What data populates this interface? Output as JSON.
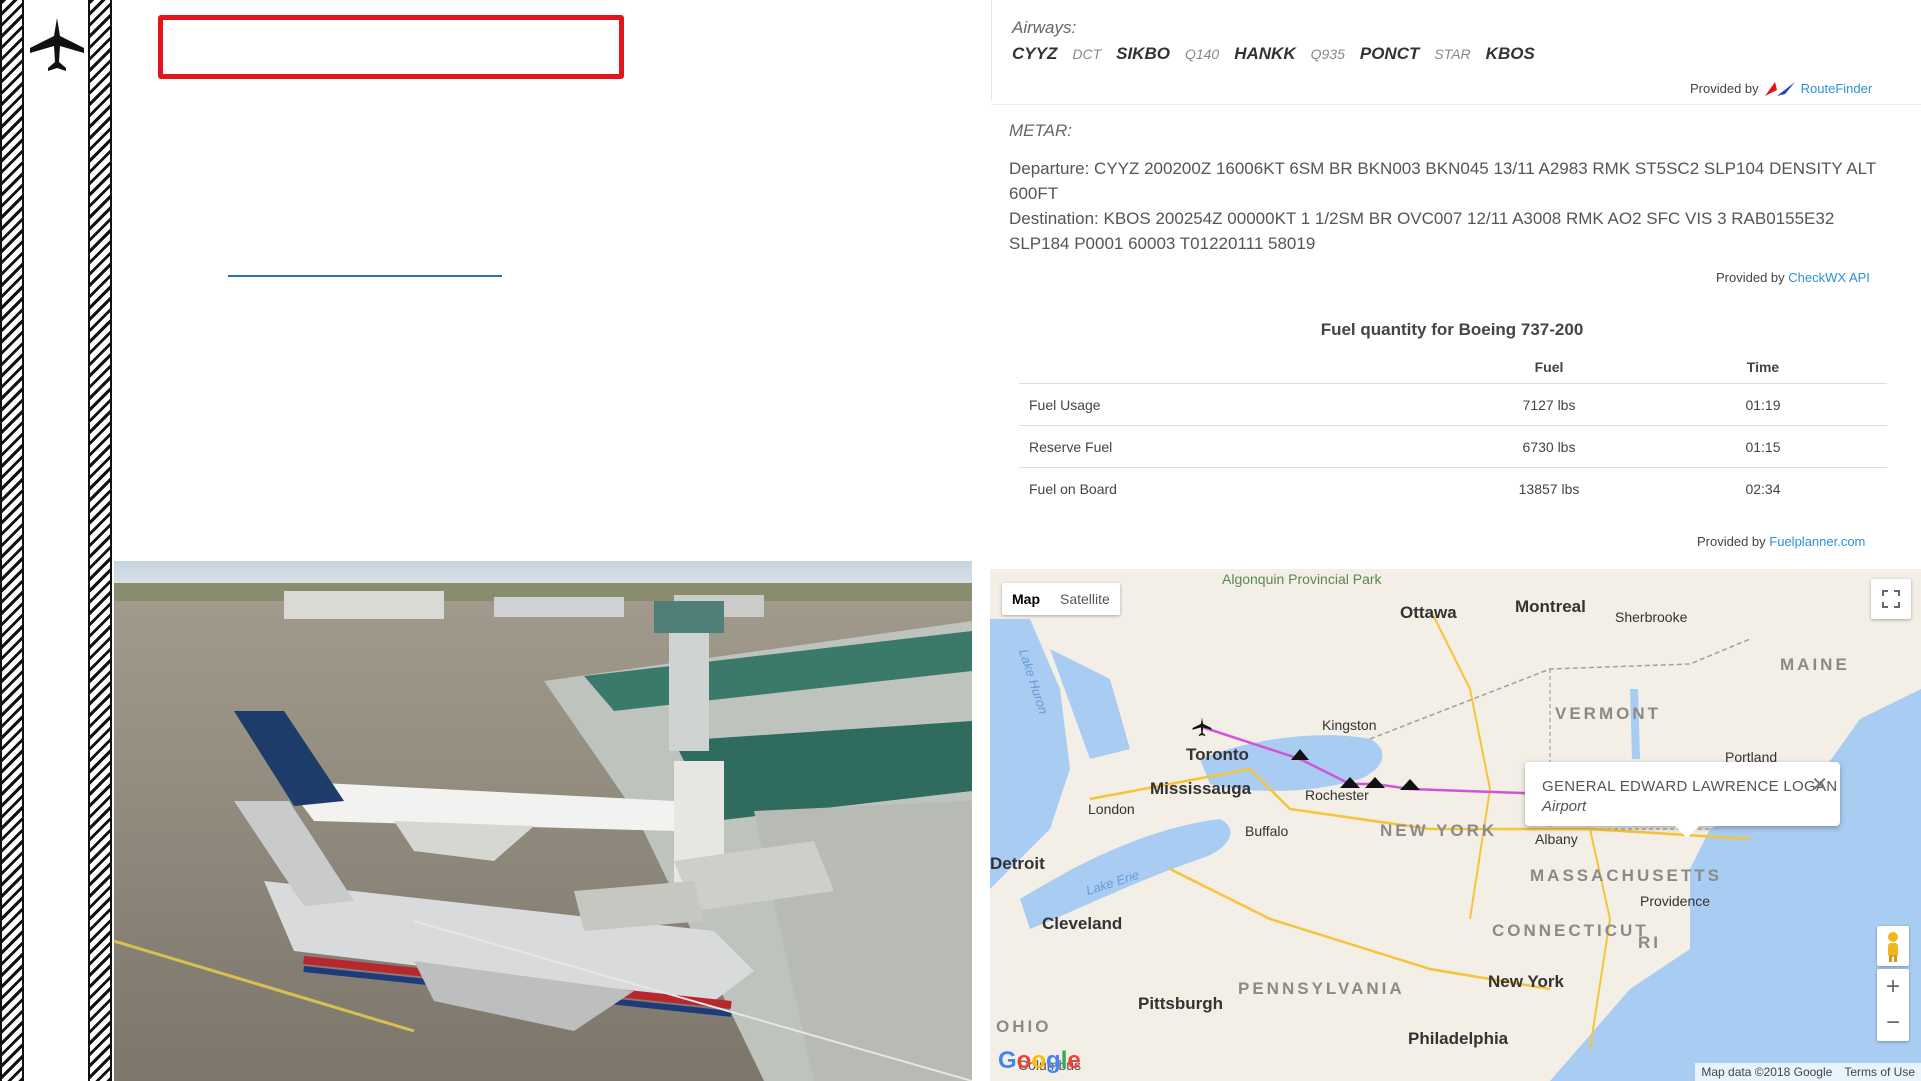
{
  "airways": {
    "label": "Airways:",
    "route": [
      {
        "id": "CYYZ",
        "kind": "waypoint"
      },
      {
        "id": "DCT",
        "kind": "airway"
      },
      {
        "id": "SIKBO",
        "kind": "waypoint"
      },
      {
        "id": "Q140",
        "kind": "airway"
      },
      {
        "id": "HANKK",
        "kind": "waypoint"
      },
      {
        "id": "Q935",
        "kind": "airway"
      },
      {
        "id": "PONCT",
        "kind": "waypoint"
      },
      {
        "id": "STAR",
        "kind": "airway"
      },
      {
        "id": "KBOS",
        "kind": "waypoint"
      }
    ],
    "provided_prefix": "Provided by",
    "provider": "RouteFinder"
  },
  "metar": {
    "label": "METAR:",
    "departure": "Departure: CYYZ 200200Z 16006KT 6SM BR BKN003 BKN045 13/11 A2983 RMK ST5SC2 SLP104 DENSITY ALT 600FT",
    "destination": "Destination: KBOS 200254Z 00000KT 1 1/2SM BR OVC007 12/11 A3008 RMK AO2 SFC VIS 3 RAB0155E32 SLP184 P0001 60003 T01220111 58019",
    "provided_prefix": "Provided by",
    "provider": "CheckWX API"
  },
  "fuel": {
    "title": "Fuel quantity for Boeing 737-200",
    "columns": [
      "",
      "Fuel",
      "Time"
    ],
    "rows": [
      {
        "label": "Fuel Usage",
        "fuel": "7127 lbs",
        "time": "01:19"
      },
      {
        "label": "Reserve Fuel",
        "fuel": "6730 lbs",
        "time": "01:15"
      },
      {
        "label": "Fuel on Board",
        "fuel": "13857 lbs",
        "time": "02:34"
      }
    ],
    "provided_prefix": "Provided by",
    "provider": "Fuelplanner.com"
  },
  "map": {
    "type_map": "Map",
    "type_satellite": "Satellite",
    "active_type": "Map",
    "infowindow": {
      "name": "GENERAL EDWARD LAWRENCE LOGAN",
      "type": "Airport"
    },
    "zoom_in": "+",
    "zoom_out": "−",
    "footer_data": "Map data ©2018 Google",
    "footer_terms": "Terms of Use",
    "logo": "Google",
    "route_color": "#d154d8",
    "labels": {
      "algonquin": "Algonquin Provincial Park",
      "ottawa": "Ottawa",
      "montreal": "Montreal",
      "sherbrooke": "Sherbrooke",
      "maine": "MAINE",
      "vermont": "VERMONT",
      "kingston": "Kingston",
      "portland": "Portland",
      "toronto": "Toronto",
      "mississauga": "Mississauga",
      "rochester": "Rochester",
      "new_york_state": "NEW YORK",
      "london": "London",
      "buffalo": "Buffalo",
      "albany": "Albany",
      "massachusetts": "MASSACHUSETTS",
      "detroit": "Detroit",
      "lake_erie": "Lake Erie",
      "lake_huron": "Lake Huron",
      "providence": "Providence",
      "cleveland": "Cleveland",
      "connecticut": "CONNECTICUT",
      "ri": "RI",
      "new_york": "New York",
      "pennsylvania": "PENNSYLVANIA",
      "pittsburgh": "Pittsburgh",
      "ohio": "OHIO",
      "philadelphia": "Philadelphia",
      "columbus": "Columbus"
    }
  },
  "colors": {
    "title_box_border": "#e2141c",
    "link_blue": "#2d8fd5",
    "water": "#a9cdf2",
    "land": "#f3eee6"
  }
}
